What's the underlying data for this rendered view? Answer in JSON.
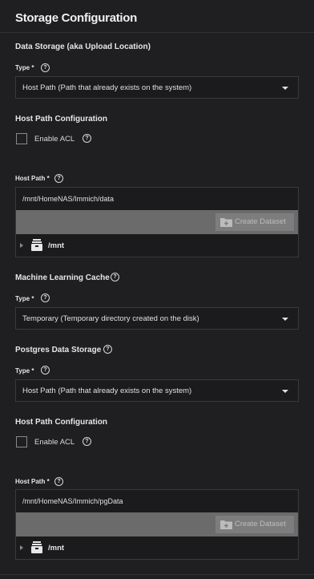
{
  "header": {
    "title": "Storage Configuration"
  },
  "data_storage": {
    "title": "Data Storage (aka Upload Location)",
    "type_label": "Type",
    "required": "*",
    "type_value": "Host Path (Path that already exists on the system)",
    "host_path_config_title": "Host Path Configuration",
    "enable_acl_label": "Enable ACL",
    "host_path_label": "Host Path",
    "host_path_value": "/mnt/HomeNAS/Immich/data",
    "create_dataset_label": "Create Dataset",
    "tree_root": "/mnt"
  },
  "ml_cache": {
    "title": "Machine Learning Cache",
    "type_label": "Type",
    "required": "*",
    "type_value": "Temporary (Temporary directory created on the disk)"
  },
  "postgres": {
    "title": "Postgres Data Storage",
    "type_label": "Type",
    "required": "*",
    "type_value": "Host Path (Path that already exists on the system)",
    "host_path_config_title": "Host Path Configuration",
    "enable_acl_label": "Enable ACL",
    "host_path_label": "Host Path",
    "host_path_value": "/mnt/HomeNAS/Immich/pgData",
    "create_dataset_label": "Create Dataset",
    "tree_root": "/mnt"
  },
  "help_glyph": "?"
}
